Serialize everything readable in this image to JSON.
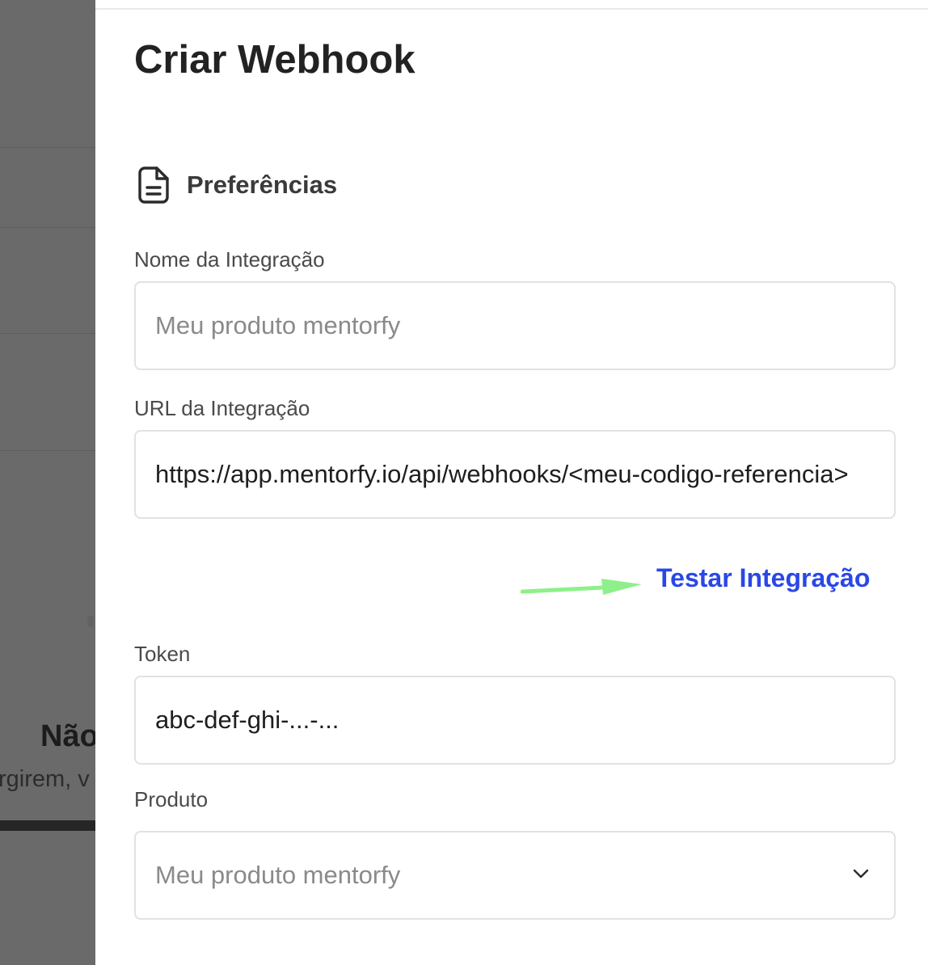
{
  "background": {
    "heading_fragment": "Não",
    "text_fragment": "rgirem, v"
  },
  "drawer": {
    "title": "Criar Webhook",
    "section": {
      "icon": "document-icon",
      "title": "Preferências"
    },
    "fields": {
      "integration_name": {
        "label": "Nome da Integração",
        "placeholder": "Meu produto mentorfy",
        "value": ""
      },
      "integration_url": {
        "label": "URL da Integração",
        "placeholder": "",
        "value": "https://app.mentorfy.io/api/webhooks/<meu-codigo-referencia>"
      },
      "token": {
        "label": "Token",
        "placeholder": "",
        "value": "abc-def-ghi-...-..."
      },
      "product": {
        "label": "Produto",
        "selected": "Meu produto mentorfy",
        "icon": "chevron-down-icon"
      }
    },
    "test_link": "Testar Integração",
    "colors": {
      "link": "#2a47e6",
      "arrow": "#8ef08a",
      "overlay": "#6a6a6a"
    }
  }
}
